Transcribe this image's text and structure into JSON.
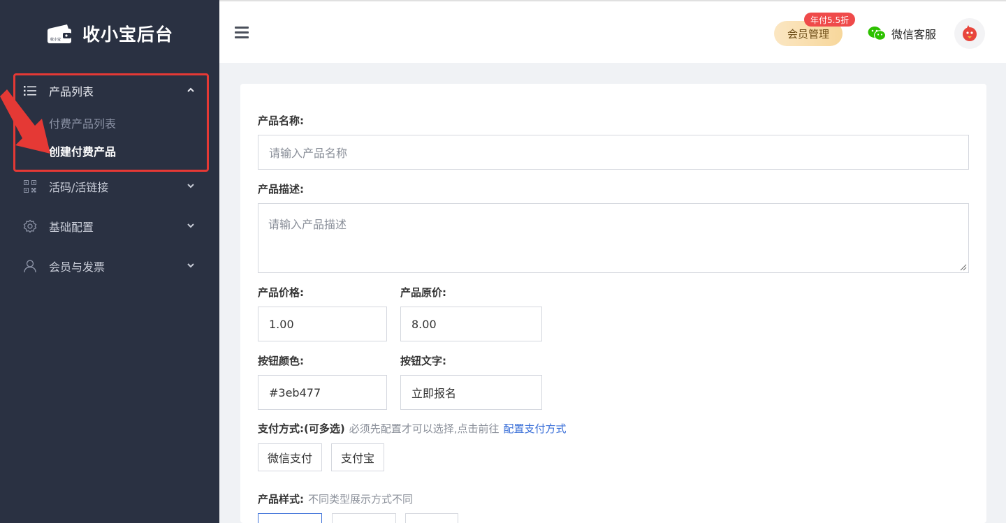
{
  "sidebar": {
    "logo_text": "收小宝后台",
    "logo_icon_text": "收小宝",
    "menu": [
      {
        "label": "产品列表",
        "icon": "list-icon",
        "expanded": true
      },
      {
        "label": "活码/活链接",
        "icon": "qrcode-icon"
      },
      {
        "label": "基础配置",
        "icon": "gear-icon"
      },
      {
        "label": "会员与发票",
        "icon": "user-icon"
      }
    ],
    "submenu": [
      {
        "label": "付费产品列表"
      },
      {
        "label": "创建付费产品",
        "active": true
      }
    ]
  },
  "header": {
    "vip_button": "会员管理",
    "vip_badge": "年付5.5折",
    "wechat_service": "微信客服"
  },
  "form": {
    "name_label": "产品名称:",
    "name_placeholder": "请输入产品名称",
    "desc_label": "产品描述:",
    "desc_placeholder": "请输入产品描述",
    "price_label": "产品价格:",
    "price_value": "1.00",
    "orig_price_label": "产品原价:",
    "orig_price_value": "8.00",
    "btn_color_label": "按钮颜色:",
    "btn_color_value": "#3eb477",
    "btn_text_label": "按钮文字:",
    "btn_text_value": "立即报名",
    "pay_label": "支付方式:(可多选)",
    "pay_hint": "必须先配置才可以选择,点击前往",
    "pay_link": "配置支付方式",
    "pay_options": [
      "微信支付",
      "支付宝"
    ],
    "style_label": "产品样式:",
    "style_hint": "不同类型展示方式不同"
  },
  "colors": {
    "sidebar_bg": "#2a3142",
    "accent_red": "#e53935",
    "link_blue": "#3a6fd8",
    "wechat_green": "#2dc100",
    "badge_red": "#ef4a4a"
  }
}
